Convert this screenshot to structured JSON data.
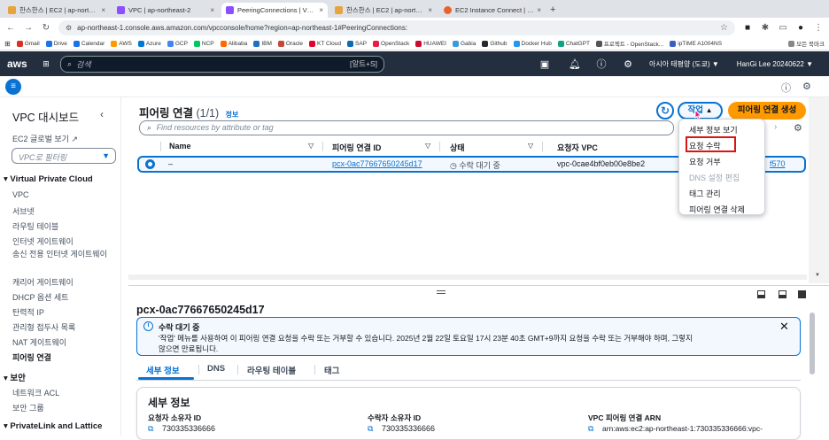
{
  "browser": {
    "tabs": [
      {
        "label": "한스한스 | EC2 | ap-northeast",
        "color": "#e8a33c",
        "active": false
      },
      {
        "label": "VPC | ap-northeast-2",
        "color": "#8c4fff",
        "active": false
      },
      {
        "label": "PeeringConnections | VPC Co",
        "color": "#8c4fff",
        "active": true
      },
      {
        "label": "한스한스 | EC2 | ap-northeast",
        "color": "#e8a33c",
        "active": false
      },
      {
        "label": "EC2 Instance Connect | ap-no",
        "color": "#e8632c",
        "active": false
      }
    ],
    "url": "ap-northeast-1.console.aws.amazon.com/vpcconsole/home?region=ap-northeast-1#PeeringConnections:",
    "bookmarks": [
      "Gmail",
      "Drive",
      "Calendar",
      "AWS",
      "Azure",
      "GCP",
      "NCP",
      "Alibaba",
      "IBM",
      "Oracle",
      "KT Cloud",
      "SAP",
      "OpenStack",
      "HUAWEI",
      "Gabia",
      "Github",
      "Docker Hub",
      "ChatGPT",
      "프로젝트 - OpenStack...",
      "ipTIME A1004NS"
    ],
    "bookmark_colors": [
      "#d93025",
      "#1a73e8",
      "#1a73e8",
      "#ff9900",
      "#0078d4",
      "#4285f4",
      "#03c75a",
      "#ff6a00",
      "#1f70c1",
      "#c74634",
      "#e4002b",
      "#0f6ab4",
      "#ed1944",
      "#cf0a2c",
      "#3a9bdc",
      "#24292f",
      "#2496ed",
      "#10a37f",
      "#555555",
      "#3b5fc0"
    ],
    "bookmark_all": "모든 북마크"
  },
  "aws_header": {
    "logo": "aws",
    "search_placeholder": "검색",
    "search_shortcut": "[알트+S]",
    "region": "아시아 태평양 (도쿄) ▼",
    "account": "HanGi Lee 20240622 ▼"
  },
  "sidebar": {
    "title": "VPC 대시보드",
    "global_view": "EC2 글로벌 보기",
    "filter_placeholder": "VPC로 필터링",
    "sections": [
      {
        "header": "Virtual Private Cloud",
        "items": [
          "VPC",
          "서브넷",
          "라우팅 테이블",
          "인터넷 게이트웨이",
          "송신 전용 인터넷 게이트웨이",
          "캐리어 게이트웨이",
          "DHCP 옵션 세트",
          "탄력적 IP",
          "관리형 접두사 목록",
          "NAT 게이트웨이",
          "피어링 연결"
        ]
      },
      {
        "header": "보안",
        "items": [
          "네트워크 ACL",
          "보안 그룹"
        ]
      },
      {
        "header": "PrivateLink and Lattice",
        "items": []
      }
    ],
    "active_item": "피어링 연결"
  },
  "main": {
    "title": "피어링 연결",
    "count": "(1/1)",
    "info": "정보",
    "actions_label": "작업",
    "actions_caret": "▲",
    "create_label": "피어링 연결 생성",
    "search_placeholder": "Find resources by attribute or tag",
    "columns": [
      "Name",
      "피어링 연결 ID",
      "상태",
      "요청자 VPC"
    ],
    "row": {
      "name": "–",
      "peering_id": "pcx-0ac77667650245d17",
      "status": "수락 대기 중",
      "requester_vpc": "vpc-0cae4bf0eb00e8be2",
      "accepter_vpc_partial": "f570"
    }
  },
  "dropdown": {
    "items": [
      {
        "label": "세부 정보 보기",
        "disabled": false
      },
      {
        "label": "요청 수락",
        "disabled": false,
        "highlight": true
      },
      {
        "label": "요청 거부",
        "disabled": false
      },
      {
        "label": "DNS 설정 편집",
        "disabled": true
      },
      {
        "label": "태그 관리",
        "disabled": false
      },
      {
        "label": "피어링 연결 삭제",
        "disabled": false
      }
    ]
  },
  "details": {
    "title": "pcx-0ac77667650245d17",
    "alert_title": "수락 대기 중",
    "alert_line1": "'작업' 메뉴를 사용하여 이 피어링 연결 요청을 수락 또는 거부할 수 있습니다. 2025년 2월 22일 토요일 17시 23분 40초 GMT+9까지 요청을 수락 또는 거부해야 하며, 그렇지",
    "alert_line2": "않으면 만료됩니다.",
    "tabs": [
      "세부 정보",
      "DNS",
      "라우팅 테이블",
      "태그"
    ],
    "section_title": "세부 정보",
    "fields": [
      {
        "label": "요청자 소유자 ID",
        "value": "730335336666"
      },
      {
        "label": "수락자 소유자 ID",
        "value": "730335336666"
      },
      {
        "label": "VPC 피어링 연결 ARN",
        "value": "arn:aws:ec2:ap-northeast-1:730335336666:vpc-"
      }
    ]
  },
  "colors": {
    "primary": "#0972d3",
    "orange": "#ff9900",
    "header": "#232f3e",
    "highlight_box": "#d91515"
  }
}
